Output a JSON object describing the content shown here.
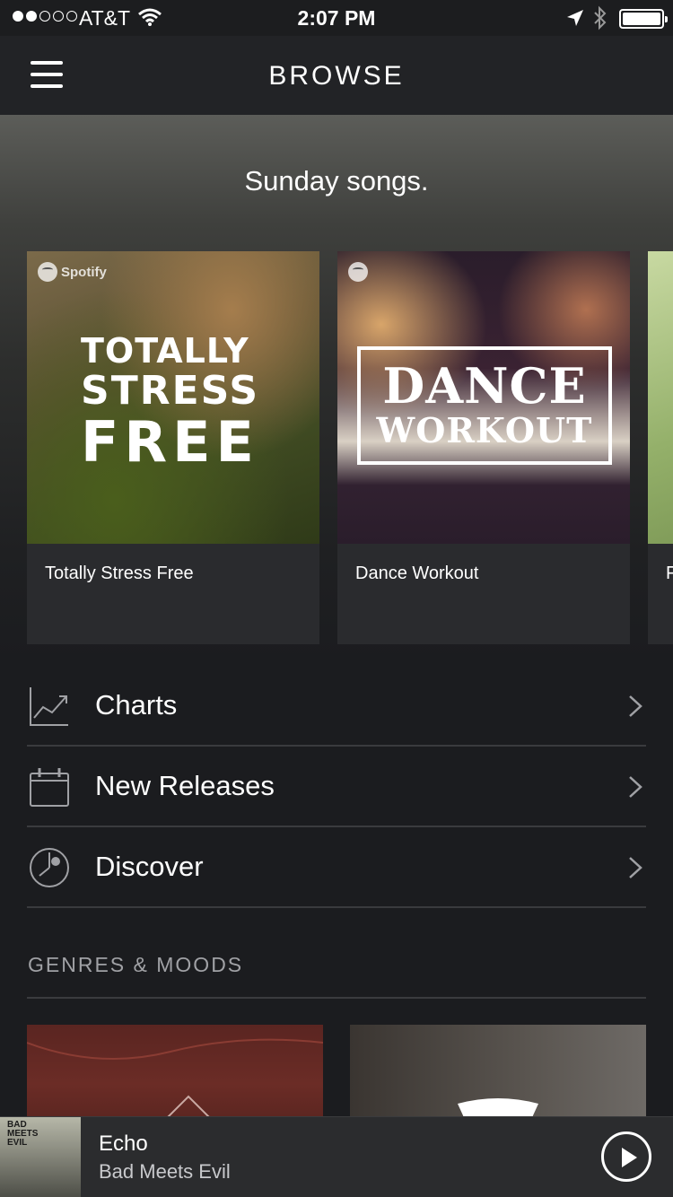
{
  "status_bar": {
    "carrier": "AT&T",
    "time": "2:07 PM",
    "signal_bars": 2
  },
  "nav": {
    "title": "BROWSE"
  },
  "hero": {
    "title": "Sunday songs.",
    "playlists": [
      {
        "name": "Totally Stress Free",
        "cover_text": [
          "TOTALLY",
          "STRESS",
          "FREE"
        ],
        "logo_text": "Spotify"
      },
      {
        "name": "Dance Workout",
        "cover_text": [
          "DANCE",
          "WORKOUT"
        ]
      },
      {
        "name": "F"
      }
    ]
  },
  "browse": {
    "items": [
      {
        "label": "Charts",
        "icon": "chart-icon"
      },
      {
        "label": "New Releases",
        "icon": "calendar-icon"
      },
      {
        "label": "Discover",
        "icon": "discover-icon"
      }
    ]
  },
  "genres": {
    "header": "GENRES & MOODS"
  },
  "now_playing": {
    "title": "Echo",
    "artist": "Bad Meets Evil",
    "album_art_text": [
      "BAD",
      "MEETS",
      "EVIL"
    ]
  },
  "colors": {
    "background": "#1b1c1f",
    "nav": "#222326",
    "card": "#2a2b2e",
    "divider": "#3a3b3e",
    "muted_text": "#a0a1a5"
  }
}
